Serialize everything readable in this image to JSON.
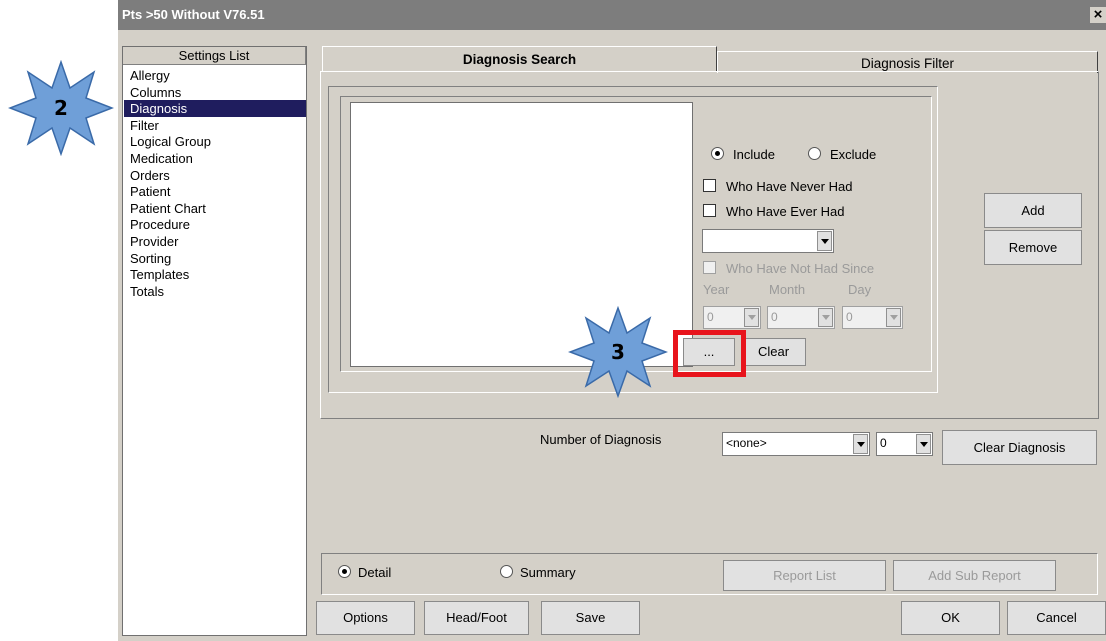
{
  "window": {
    "title": "Pts >50 Without V76.51",
    "close_label": "×"
  },
  "settings": {
    "header": "Settings List",
    "items": [
      "Allergy",
      "Columns",
      "Diagnosis",
      "Filter",
      "Logical Group",
      "Medication",
      "Orders",
      "Patient",
      "Patient Chart",
      "Procedure",
      "Provider",
      "Sorting",
      "Templates",
      "Totals"
    ],
    "selected": "Diagnosis"
  },
  "tabs": {
    "search": "Diagnosis Search",
    "filter": "Diagnosis Filter"
  },
  "search_panel": {
    "include_label": "Include",
    "exclude_label": "Exclude",
    "include_selected": true,
    "never_had_label": "Who Have Never Had",
    "ever_had_label": "Who Have Ever Had",
    "not_had_since_label": "Who Have Not Had Since",
    "combo_value": "",
    "year_label": "Year",
    "month_label": "Month",
    "day_label": "Day",
    "year_value": "0",
    "month_value": "0",
    "day_value": "0",
    "ellipsis_label": "...",
    "clear_label": "Clear"
  },
  "side_buttons": {
    "add": "Add",
    "remove": "Remove"
  },
  "number_row": {
    "label": "Number of Diagnosis",
    "count_value": "<none>",
    "index_value": "0",
    "clear_diag_label": "Clear Diagnosis"
  },
  "mode": {
    "detail": "Detail",
    "summary": "Summary",
    "detail_selected": true
  },
  "report": {
    "report_list": "Report List",
    "add_sub_report": "Add Sub Report"
  },
  "footer": {
    "options": "Options",
    "head_foot": "Head/Foot",
    "save": "Save",
    "ok": "OK",
    "cancel": "Cancel"
  },
  "annotations": {
    "step2": "2",
    "step3": "3",
    "star_color": "#6f9fd8",
    "highlight_color": "#e8141c"
  }
}
